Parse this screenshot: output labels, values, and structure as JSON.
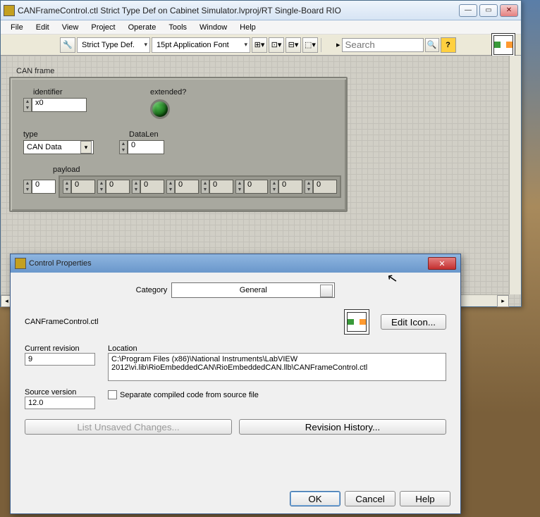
{
  "main_window": {
    "title": "CANFrameControl.ctl Strict Type Def on Cabinet Simulator.lvproj/RT Single-Board RIO",
    "menus": [
      "File",
      "Edit",
      "View",
      "Project",
      "Operate",
      "Tools",
      "Window",
      "Help"
    ],
    "toolbar": {
      "typedef_mode": "Strict Type Def.",
      "font": "15pt Application Font",
      "search_placeholder": "Search"
    }
  },
  "cluster": {
    "title": "CAN frame",
    "identifier": {
      "label": "identifier",
      "prefix": "x",
      "value": "0"
    },
    "extended": {
      "label": "extended?",
      "on": true
    },
    "type": {
      "label": "type",
      "value": "CAN Data"
    },
    "datalen": {
      "label": "DataLen",
      "value": "0"
    },
    "payload": {
      "label": "payload",
      "index": "0",
      "cells": [
        "0",
        "0",
        "0",
        "0",
        "0",
        "0",
        "0",
        "0"
      ]
    }
  },
  "dialog": {
    "title": "Control Properties",
    "category_label": "Category",
    "category_value": "General",
    "ctl_name": "CANFrameControl.ctl",
    "edit_icon": "Edit Icon...",
    "rev_label": "Current revision",
    "rev_value": "9",
    "loc_label": "Location",
    "loc_value": "C:\\Program Files (x86)\\National Instruments\\LabVIEW 2012\\vi.lib\\RioEmbeddedCAN\\RioEmbeddedCAN.llb\\CANFrameControl.ctl",
    "src_label": "Source version",
    "src_value": "12.0",
    "sep_label": "Separate compiled code from source file",
    "list_unsaved": "List Unsaved Changes...",
    "rev_history": "Revision History...",
    "ok": "OK",
    "cancel": "Cancel",
    "help": "Help"
  }
}
